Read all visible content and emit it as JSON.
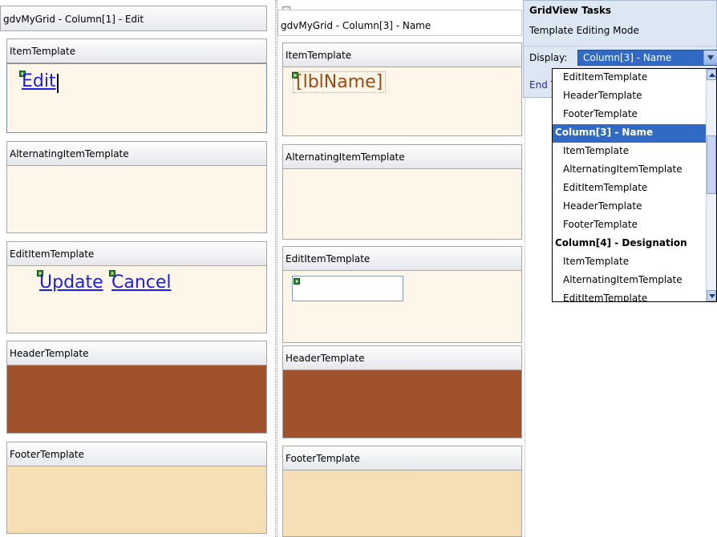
{
  "left_panel": {
    "title": "gdvMyGrid - Column[1] - Edit",
    "sections": [
      "ItemTemplate",
      "AlternatingItemTemplate",
      "EditItemTemplate",
      "HeaderTemplate",
      "FooterTemplate"
    ],
    "item_link": "Edit",
    "update_link": "Update",
    "cancel_link": "Cancel"
  },
  "middle_panel": {
    "title": "gdvMyGrid - Column[3] - Name",
    "sections": [
      "ItemTemplate",
      "AlternatingItemTemplate",
      "EditItemTemplate",
      "HeaderTemplate",
      "FooterTemplate"
    ],
    "label_text": "[lblName]"
  },
  "smart_tag": {
    "title": "GridView Tasks",
    "mode": "Template Editing Mode",
    "display_label": "Display:",
    "display_value": "Column[3] - Name",
    "end_link": "End T",
    "options": [
      {
        "label": "EditItemTemplate",
        "type": "item"
      },
      {
        "label": "HeaderTemplate",
        "type": "item"
      },
      {
        "label": "FooterTemplate",
        "type": "item"
      },
      {
        "label": "Column[3] - Name",
        "type": "group",
        "selected": true
      },
      {
        "label": "ItemTemplate",
        "type": "item"
      },
      {
        "label": "AlternatingItemTemplate",
        "type": "item"
      },
      {
        "label": "EditItemTemplate",
        "type": "item"
      },
      {
        "label": "HeaderTemplate",
        "type": "item"
      },
      {
        "label": "FooterTemplate",
        "type": "item"
      },
      {
        "label": "Column[4] - Designation",
        "type": "group"
      },
      {
        "label": "ItemTemplate",
        "type": "item"
      },
      {
        "label": "AlternatingItemTemplate",
        "type": "item"
      },
      {
        "label": "EditItemTemplate",
        "type": "item"
      }
    ]
  },
  "colors": {
    "header_template": "#a0522d",
    "footer_template": "#f6dfb4",
    "template_body": "#fef6e8",
    "selection": "#316ac5",
    "link": "#1a1ee8"
  }
}
